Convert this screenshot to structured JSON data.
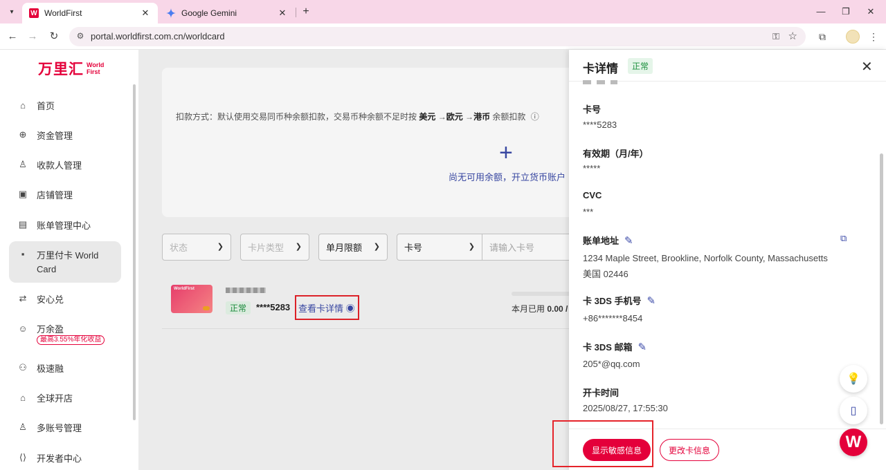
{
  "browser": {
    "tabs": [
      {
        "title": "WorldFirst",
        "favicon": "W"
      },
      {
        "title": "Google Gemini"
      }
    ],
    "url": "portal.worldfirst.com.cn/worldcard"
  },
  "logo": {
    "cn": "万里汇",
    "en_line1": "World",
    "en_line2": "First"
  },
  "sidebar": {
    "items": [
      {
        "label": "首页",
        "icon": "home-icon"
      },
      {
        "label": "资金管理",
        "icon": "funds-icon"
      },
      {
        "label": "收款人管理",
        "icon": "user-icon"
      },
      {
        "label": "店铺管理",
        "icon": "store-icon"
      },
      {
        "label": "账单管理中心",
        "icon": "bill-icon"
      },
      {
        "label_line1": "万里付卡 World",
        "label_line2": "Card",
        "icon": "card-icon"
      },
      {
        "label": "安心兑",
        "icon": "exchange-icon"
      },
      {
        "label": "万余盈",
        "icon": "smile-icon",
        "badge": "最高3.55%年化收益"
      },
      {
        "label": "极速融",
        "icon": "finance-icon"
      },
      {
        "label": "全球开店",
        "icon": "global-store-icon"
      },
      {
        "label": "多账号管理",
        "icon": "multi-user-icon"
      },
      {
        "label": "开发者中心",
        "icon": "dev-icon"
      }
    ]
  },
  "balance": {
    "note_prefix": "扣款方式：默认使用交易同币种余额扣款，交易币种余额不足时按 ",
    "cur1": "美元",
    "arrow1": " →",
    "cur2": "欧元",
    "arrow2": " →",
    "cur3": "港币",
    "note_suffix": " 余额扣款",
    "empty_text": "尚无可用余额，开立货币账户"
  },
  "filters": {
    "status": "状态",
    "card_type": "卡片类型",
    "monthly_limit": "单月限额",
    "card_no": "卡号",
    "card_input_placeholder": "请输入卡号"
  },
  "card_row": {
    "brand": "WorldFirst",
    "status": "正常",
    "last4": "****5283",
    "view_detail": "查看卡详情",
    "usage_label": "本月已用",
    "usage_value": "0.00 /"
  },
  "drawer": {
    "title": "卡详情",
    "status": "正常",
    "fields": {
      "card_no_label": "卡号",
      "card_no_value": "****5283",
      "expiry_label": "有效期（月/年）",
      "expiry_value": "*****",
      "cvc_label": "CVC",
      "cvc_value": "***",
      "billing_label": "账单地址",
      "billing_line1": "1234 Maple Street, Brookline, Norfolk County, Massachusetts",
      "billing_line2": "美国 02446",
      "phone_label": "卡 3DS 手机号",
      "phone_value": "+86*******8454",
      "email_label": "卡 3DS 邮箱",
      "email_value": "205*@qq.com",
      "open_time_label": "开卡时间",
      "open_time_value": "2025/08/27, 17:55:30"
    },
    "buttons": {
      "show_sensitive": "显示敏感信息",
      "change_info": "更改卡信息"
    }
  },
  "colors": {
    "brand": "#e4003a",
    "accent": "#3b4aa8",
    "success": "#1a8f3c"
  }
}
